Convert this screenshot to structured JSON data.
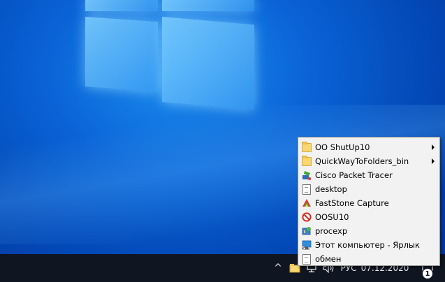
{
  "taskbar": {
    "tray_chevron": "^",
    "language": "РУС",
    "date": "07.12.2020",
    "notification_count": "1"
  },
  "context_menu": {
    "items": [
      {
        "label": "OO ShutUp10",
        "icon": "folder-icon",
        "submenu": true
      },
      {
        "label": "QuickWayToFolders_bin",
        "icon": "folder-icon",
        "submenu": true
      },
      {
        "label": "Cisco Packet Tracer",
        "icon": "packet-tracer-icon",
        "submenu": false
      },
      {
        "label": "desktop",
        "icon": "document-icon",
        "submenu": false
      },
      {
        "label": "FastStone Capture",
        "icon": "faststone-icon",
        "submenu": false
      },
      {
        "label": "OOSU10",
        "icon": "oosu10-icon",
        "submenu": false
      },
      {
        "label": "procexp",
        "icon": "procexp-icon",
        "submenu": false
      },
      {
        "label": "Этот компьютер - Ярлык",
        "icon": "this-pc-shortcut-icon",
        "submenu": false
      },
      {
        "label": "обмен",
        "icon": "document-icon",
        "submenu": false
      }
    ]
  },
  "colors": {
    "taskbar": "#101522",
    "menu_background": "#f2f2f2",
    "desktop_accent": "#0a63d6"
  }
}
